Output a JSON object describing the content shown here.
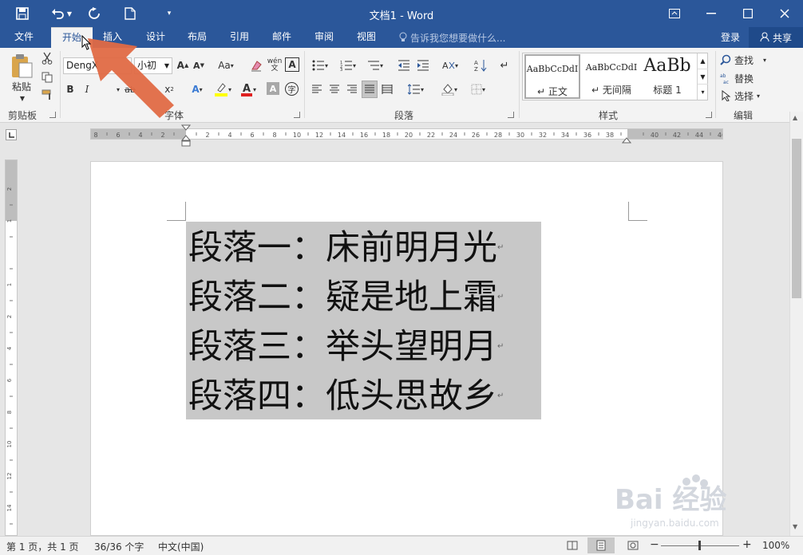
{
  "titlebar": {
    "title": "文档1 - Word",
    "save_icon": "save-icon",
    "undo_icon": "undo-icon",
    "redo_icon": "redo-icon",
    "new_icon": "new-document-icon"
  },
  "tabs": [
    {
      "label": "文件",
      "active": false
    },
    {
      "label": "开始",
      "active": true
    },
    {
      "label": "插入",
      "active": false
    },
    {
      "label": "设计",
      "active": false
    },
    {
      "label": "布局",
      "active": false
    },
    {
      "label": "引用",
      "active": false
    },
    {
      "label": "邮件",
      "active": false
    },
    {
      "label": "审阅",
      "active": false
    },
    {
      "label": "视图",
      "active": false
    }
  ],
  "tell_me": "告诉我您想要做什么...",
  "login": "登录",
  "share": "共享",
  "ribbon": {
    "clipboard": {
      "paste": "粘贴",
      "label": "剪贴板"
    },
    "font": {
      "name": "DengX",
      "size": "小初",
      "label": "字体"
    },
    "paragraph": {
      "label": "段落"
    },
    "styles": {
      "label": "样式",
      "items": [
        {
          "sample": "AaBbCcDdI",
          "name": "正文"
        },
        {
          "sample": "AaBbCcDdI",
          "name": "无间隔"
        },
        {
          "sample": "AaBb",
          "name": "标题 1"
        }
      ]
    },
    "editing": {
      "find": "查找",
      "replace": "替换",
      "select": "选择",
      "label": "编辑"
    }
  },
  "ruler": {
    "labels": [
      "8",
      "6",
      "4",
      "2",
      "",
      "2",
      "4",
      "6",
      "8",
      "10",
      "12",
      "14",
      "16",
      "18",
      "20",
      "22",
      "24",
      "26",
      "28",
      "30",
      "32",
      "34",
      "36",
      "38",
      "",
      "40",
      "42",
      "44",
      "46",
      "48"
    ],
    "vlabels": [
      "2",
      "1",
      "",
      "1",
      "2",
      "4",
      "6",
      "8",
      "10",
      "12",
      "14",
      "16",
      "18"
    ]
  },
  "document": {
    "paragraphs": [
      "段落一：床前明月光",
      "段落二：疑是地上霜",
      "段落三：举头望明月",
      "段落四：低头思故乡"
    ],
    "selected": true
  },
  "status": {
    "page": "第 1 页，共 1 页",
    "words": "36/36 个字",
    "language": "中文(中国)",
    "zoom": "100%"
  },
  "watermark": {
    "text": "Bai 经验",
    "url": "jingyan.baidu.com"
  },
  "colors": {
    "accent": "#2b579a",
    "arrow": "#e06a45",
    "selection": "#c8c8c8"
  }
}
